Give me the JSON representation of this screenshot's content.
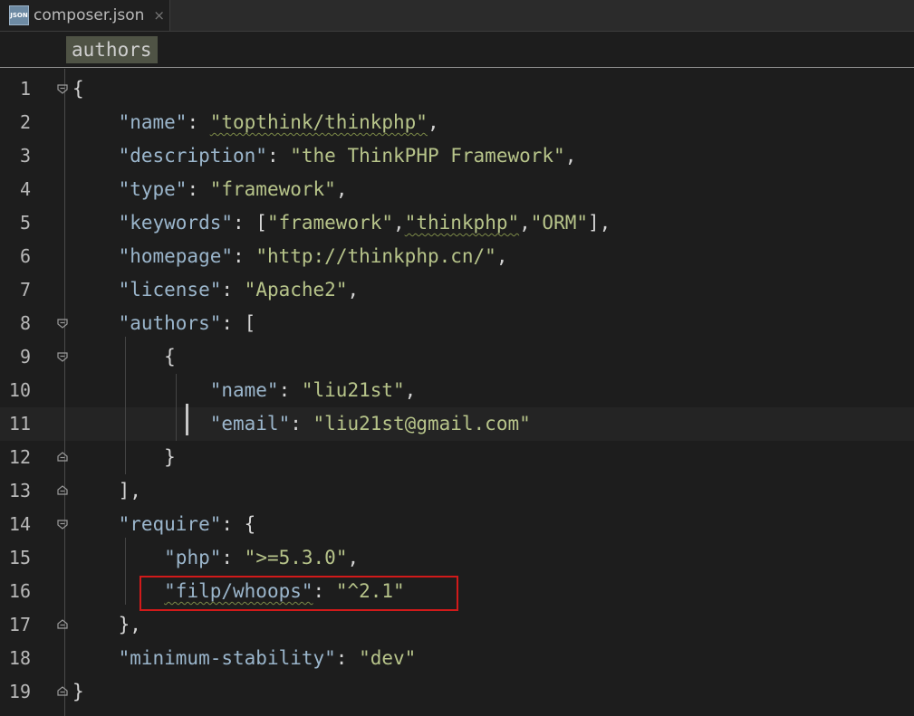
{
  "tab": {
    "filename": "composer.json",
    "icon": "json-file-icon",
    "icon_label": "JSON",
    "close": "×"
  },
  "breadcrumb": {
    "label": "authors"
  },
  "lines": [
    {
      "num": "1"
    },
    {
      "num": "2",
      "key": "\"name\"",
      "value": "\"topthink/thinkphp\""
    },
    {
      "num": "3",
      "key": "\"description\"",
      "value": "\"the ThinkPHP Framework\""
    },
    {
      "num": "4",
      "key": "\"type\"",
      "value": "\"framework\""
    },
    {
      "num": "5",
      "key": "\"keywords\"",
      "values": [
        "\"framework\"",
        "\"thinkphp\"",
        "\"ORM\""
      ]
    },
    {
      "num": "6",
      "key": "\"homepage\"",
      "value": "\"http://thinkphp.cn/\""
    },
    {
      "num": "7",
      "key": "\"license\"",
      "value": "\"Apache2\""
    },
    {
      "num": "8",
      "key": "\"authors\""
    },
    {
      "num": "9"
    },
    {
      "num": "10",
      "key": "\"name\"",
      "value": "\"liu21st\""
    },
    {
      "num": "11",
      "key": "\"email\"",
      "value": "\"liu21st@gmail.com\""
    },
    {
      "num": "12"
    },
    {
      "num": "13"
    },
    {
      "num": "14",
      "key": "\"require\""
    },
    {
      "num": "15",
      "key": "\"php\"",
      "value": "\">=5.3.0\""
    },
    {
      "num": "16",
      "key": "\"filp/whoops\"",
      "value": "\"^2.1\""
    },
    {
      "num": "17"
    },
    {
      "num": "18",
      "key": "\"minimum-stability\"",
      "value": "\"dev\""
    },
    {
      "num": "19"
    }
  ],
  "colors": {
    "key": "#9bb6cc",
    "string": "#b7c48a",
    "highlight": "#d11a1a",
    "background": "#1d1d1d"
  }
}
